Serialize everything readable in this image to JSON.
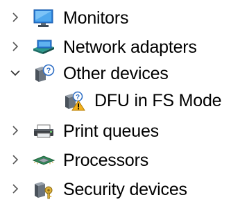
{
  "tree": {
    "items": [
      {
        "label": "Monitors",
        "icon": "monitor-icon",
        "expanded": false
      },
      {
        "label": "Network adapters",
        "icon": "network-adapter-icon",
        "expanded": false
      },
      {
        "label": "Other devices",
        "icon": "unknown-device-icon",
        "expanded": true
      },
      {
        "label": "DFU in FS Mode",
        "icon": "unknown-device-warning-icon",
        "child": true
      },
      {
        "label": "Print queues",
        "icon": "printer-icon",
        "expanded": false
      },
      {
        "label": "Processors",
        "icon": "processor-icon",
        "expanded": false
      },
      {
        "label": "Security devices",
        "icon": "security-device-icon",
        "expanded": false
      }
    ]
  }
}
